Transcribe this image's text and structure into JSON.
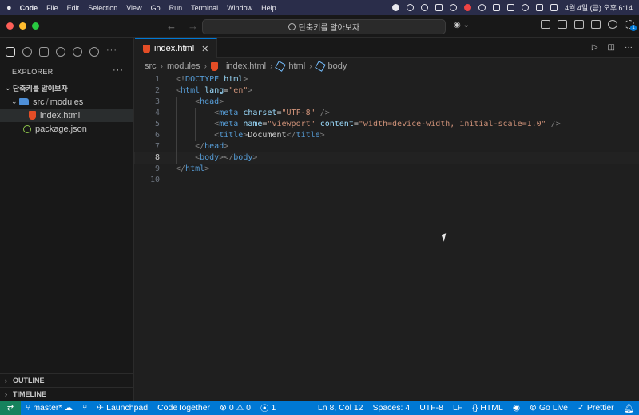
{
  "menubar": {
    "apple": "",
    "items": [
      "Code",
      "File",
      "Edit",
      "Selection",
      "View",
      "Go",
      "Run",
      "Terminal",
      "Window",
      "Help"
    ],
    "clock": "4월 4일 (금) 오후 6:14"
  },
  "titlebar": {
    "command_center": "단축키를 알아보자",
    "badge_count": "1"
  },
  "sidebar": {
    "explorer_title": "EXPLORER",
    "more": "···",
    "root_folder": "단축키를 알아보자",
    "folder": "src",
    "folder_sep": "/",
    "subfolder": "modules",
    "files": [
      "index.html",
      "package.json"
    ],
    "outline": "OUTLINE",
    "timeline": "TIMELINE"
  },
  "editor": {
    "tab_label": "index.html",
    "breadcrumb": [
      "src",
      "modules",
      "index.html",
      "html",
      "body"
    ],
    "line_numbers": [
      "1",
      "2",
      "3",
      "4",
      "5",
      "6",
      "7",
      "8",
      "9",
      "10"
    ],
    "current_line": 8
  },
  "statusbar": {
    "branch": "master*",
    "launchpad": "Launchpad",
    "codetogether": "CodeTogether",
    "errors": "0",
    "warnings": "0",
    "ports": "1",
    "position": "Ln 8, Col 12",
    "spaces": "Spaces: 4",
    "encoding": "UTF-8",
    "eol": "LF",
    "language": "HTML",
    "golive": "Go Live",
    "prettier": "Prettier"
  },
  "colors": {
    "accent": "#0078d4",
    "remote": "#16825d",
    "html_icon": "#e44d26",
    "json_icon": "#8bc34a"
  }
}
